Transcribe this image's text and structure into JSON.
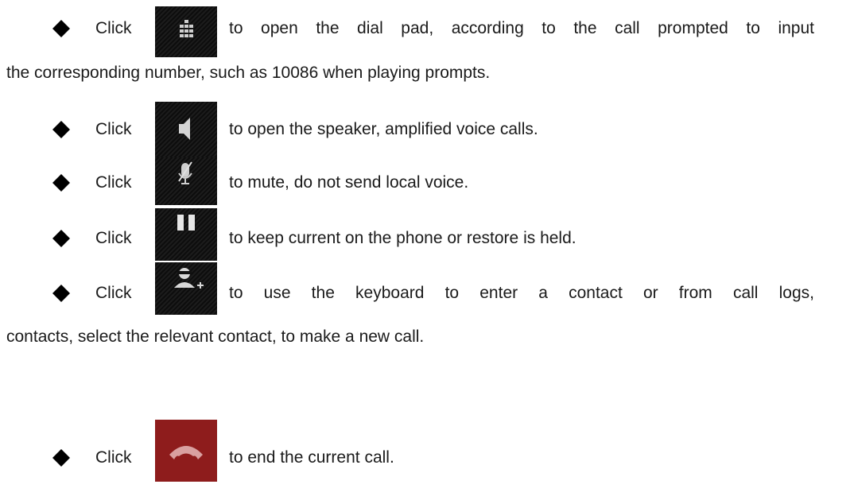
{
  "items": [
    {
      "lead": "Click",
      "text": "to open the dial pad, according to the call prompted to input",
      "continuation": "the corresponding number, such as 10086 when playing prompts.",
      "icon": "dialpad-icon"
    },
    {
      "lead": "Click",
      "text": "to open the speaker, amplified voice calls.",
      "icon": "speaker-icon"
    },
    {
      "lead": "Click",
      "text": "to mute, do not send local voice.",
      "icon": "mute-microphone-icon"
    },
    {
      "lead": "Click",
      "text": "to keep current on the phone or restore is held.",
      "icon": "pause-icon"
    },
    {
      "lead": "Click",
      "text": "to use the keyboard to enter a contact or from call logs,",
      "continuation": "contacts, select the relevant contact, to make a new call.",
      "icon": "add-contact-icon"
    },
    {
      "lead": "Click",
      "text": "to end the current call.",
      "icon": "end-call-icon"
    }
  ],
  "colors": {
    "end_call": "#8e1c1c",
    "icon_bg": "#111111",
    "text": "#1a1a1a"
  }
}
